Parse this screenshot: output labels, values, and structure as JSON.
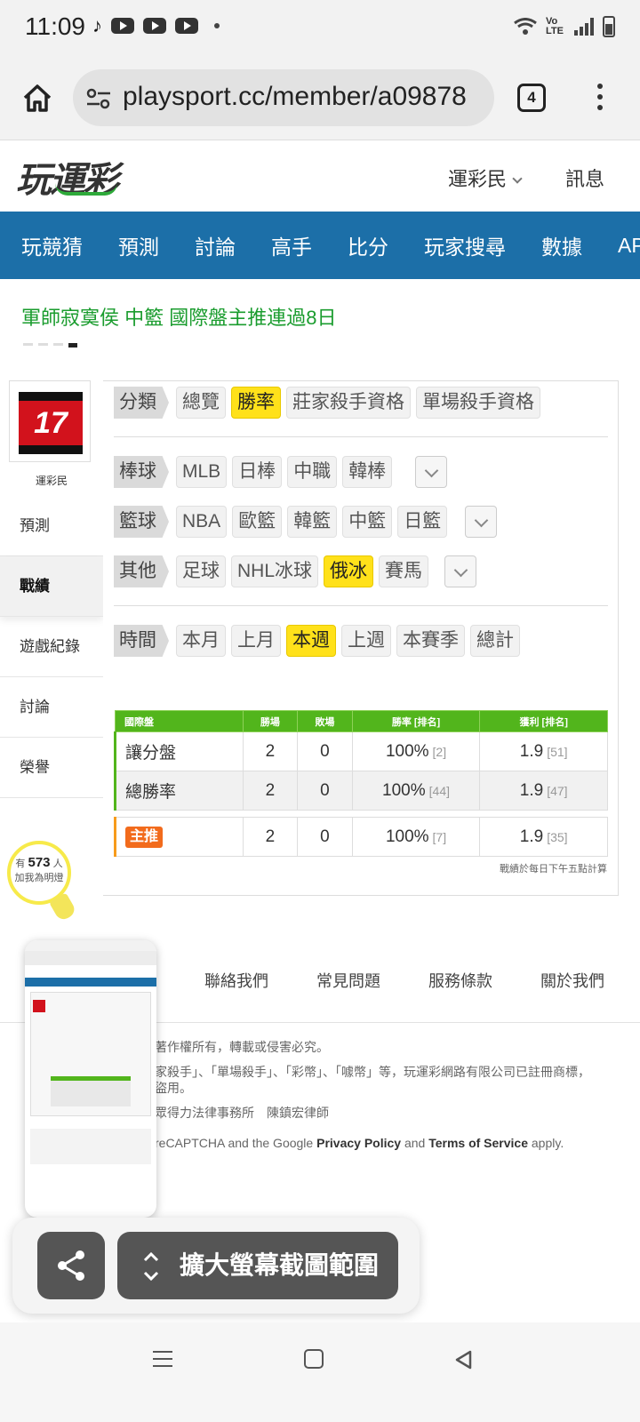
{
  "status_bar": {
    "time": "11:09",
    "network": "Vo LTE"
  },
  "browser": {
    "url": "playsport.cc/member/a09878",
    "tab_count": "4"
  },
  "site": {
    "logo": "玩運彩",
    "user_menu": "運彩民",
    "messages": "訊息",
    "nav": [
      "玩競猜",
      "預測",
      "討論",
      "高手",
      "比分",
      "玩家搜尋",
      "數據",
      "APP"
    ]
  },
  "banner": {
    "text": "軍師寂寞侯 中籃 國際盤主推連過8日"
  },
  "sidebar": {
    "avatar_text": "17",
    "user_name": "運彩民",
    "items": [
      "預測",
      "戰績",
      "遊戲紀錄",
      "討論",
      "榮譽"
    ],
    "fans_prefix": "有",
    "fans_count": "573",
    "fans_suffix": "人",
    "fans_cta": "加我為明燈"
  },
  "filters": {
    "category_label": "分類",
    "category_options": [
      "總覽",
      "勝率",
      "莊家殺手資格",
      "單場殺手資格"
    ],
    "baseball_label": "棒球",
    "baseball_options": [
      "MLB",
      "日棒",
      "中職",
      "韓棒"
    ],
    "basketball_label": "籃球",
    "basketball_options": [
      "NBA",
      "歐籃",
      "韓籃",
      "中籃",
      "日籃"
    ],
    "other_label": "其他",
    "other_options": [
      "足球",
      "NHL冰球",
      "俄冰",
      "賽馬"
    ],
    "time_label": "時間",
    "time_options": [
      "本月",
      "上月",
      "本週",
      "上週",
      "本賽季",
      "總計"
    ]
  },
  "stats_table": {
    "headers": [
      "國際盤",
      "勝場",
      "敗場",
      "勝率 [排名]",
      "獲利 [排名]"
    ],
    "rows": [
      {
        "label": "讓分盤",
        "wins": "2",
        "losses": "0",
        "win_rate": "100%",
        "win_rank": "[2]",
        "profit": "1.9",
        "profit_rank": "[51]"
      },
      {
        "label": "總勝率",
        "wins": "2",
        "losses": "0",
        "win_rate": "100%",
        "win_rank": "[44]",
        "profit": "1.9",
        "profit_rank": "[47]"
      },
      {
        "label": "主推",
        "wins": "2",
        "losses": "0",
        "win_rate": "100%",
        "win_rank": "[7]",
        "profit": "1.9",
        "profit_rank": "[35]"
      }
    ],
    "note": "戰績於每日下午五點計算"
  },
  "footer": {
    "links": [
      "聯絡我們",
      "常見問題",
      "服務條款",
      "關於我們"
    ],
    "copyright": "著作權所有，轉載或侵害必究。",
    "trademark_1": "家殺手」、「單場殺手」、「彩幣」、「噱幣」等，玩運彩網路有限公司已註冊商標，",
    "trademark_2": "盜用。",
    "lawyer": "眾得力法律事務所　陳鎮宏律師",
    "recaptcha_pre": "reCAPTCHA and the Google ",
    "privacy": "Privacy Policy",
    "and": " and ",
    "terms": "Terms of Service",
    "apply": " apply."
  },
  "screenshot_toolbar": {
    "expand_label": "擴大螢幕截圖範圍"
  }
}
